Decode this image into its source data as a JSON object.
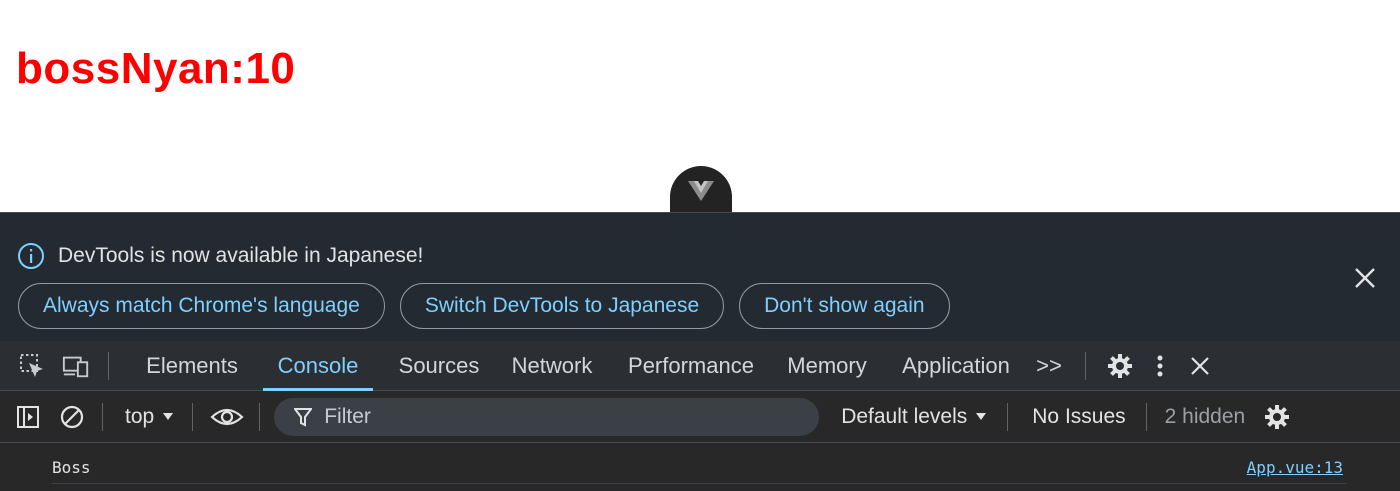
{
  "page": {
    "heading": "bossNyan:10"
  },
  "vue_devtools_toggle": {
    "icon": "vue-logo-icon"
  },
  "colors": {
    "heading": "#ff0000",
    "accent": "#7fcfff",
    "panel_bg": "#282828",
    "infobar_bg": "#232a31"
  },
  "infobar": {
    "message": "DevTools is now available in Japanese!",
    "buttons": [
      "Always match Chrome's language",
      "Switch DevTools to Japanese",
      "Don't show again"
    ]
  },
  "tabs": [
    "Elements",
    "Console",
    "Sources",
    "Network",
    "Performance",
    "Memory",
    "Application"
  ],
  "active_tab": "Console",
  "more_tabs_label": ">>",
  "toolbar": {
    "context": "top",
    "filter_placeholder": "Filter",
    "levels": "Default levels",
    "issues": "No Issues",
    "hidden": "2 hidden"
  },
  "console": {
    "messages": [
      {
        "text": "Boss",
        "source": "App.vue:13"
      }
    ]
  }
}
